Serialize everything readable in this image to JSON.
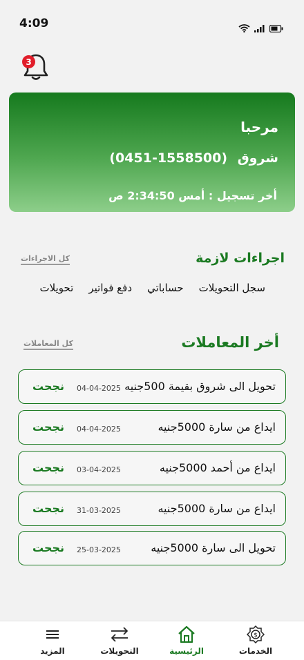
{
  "status_bar": {
    "time": "4:09"
  },
  "notifications": {
    "count": "3"
  },
  "greeting": {
    "welcome": "مرحبا",
    "user_name": "شروق",
    "account_number": "(1558500-0451)",
    "last_login": "أخر تسجيل : أمس 2:34:50 ص"
  },
  "quick_section": {
    "title": "اجراءات لازمة",
    "all_link": "كل الاجراءات",
    "actions": [
      "تحويلات",
      "دفع فواتير",
      "حساباتي",
      "سجل التحويلات"
    ]
  },
  "transactions_section": {
    "title": "أخر المعاملات",
    "all_link": "كل المعاملات",
    "items": [
      {
        "description": "تحويل الى شروق  بقيمة 500جنيه",
        "date": "04-04-2025",
        "status": "نجحت"
      },
      {
        "description": "ايداع من سارة  5000جنيه",
        "date": "04-04-2025",
        "status": "نجحت"
      },
      {
        "description": "ايداع من أحمد  5000جنيه",
        "date": "03-04-2025",
        "status": "نجحت"
      },
      {
        "description": "ايداع من سارة  5000جنيه",
        "date": "31-03-2025",
        "status": "نجحت"
      },
      {
        "description": "تحويل الى سارة  5000جنيه",
        "date": "25-03-2025",
        "status": "نجحت"
      }
    ]
  },
  "bottom_nav": {
    "items": [
      {
        "label": "الخدمات",
        "icon": "services-coin-icon"
      },
      {
        "label": "الرئيسية",
        "icon": "home-icon",
        "active": true
      },
      {
        "label": "التحويلات",
        "icon": "transfer-arrows-icon"
      },
      {
        "label": "المزيد",
        "icon": "menu-icon"
      }
    ]
  },
  "colors": {
    "brand_green": "#1b7a22",
    "badge_red": "#e11d2a",
    "background": "#f2f2f2"
  }
}
